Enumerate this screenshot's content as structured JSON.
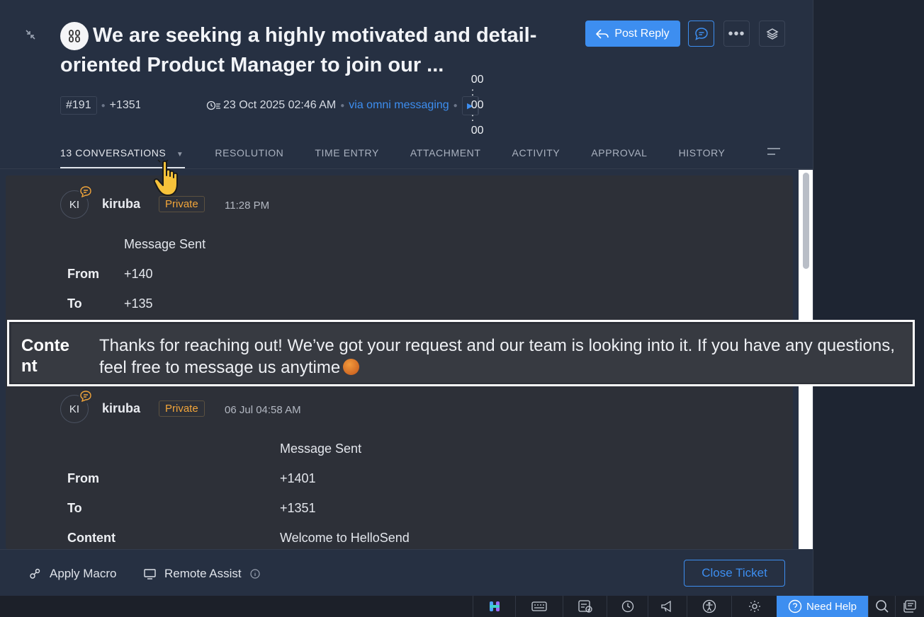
{
  "ticket": {
    "title": "We are seeking a highly motivated and detail-oriented Product Manager to join our ...",
    "id": "#191",
    "phone": "+1351",
    "created": "23 Oct 2025 02:46 AM",
    "channel": "via omni messaging",
    "timer": "00 : 00 : 00"
  },
  "header": {
    "post_reply": "Post Reply"
  },
  "tabs": [
    {
      "label": "13 CONVERSATIONS"
    },
    {
      "label": "RESOLUTION"
    },
    {
      "label": "TIME ENTRY"
    },
    {
      "label": "ATTACHMENT"
    },
    {
      "label": "ACTIVITY"
    },
    {
      "label": "APPROVAL"
    },
    {
      "label": "HISTORY"
    }
  ],
  "conversations": [
    {
      "initials": "KI",
      "author": "kiruba",
      "badge": "Private",
      "time": "11:28 PM",
      "heading": "Message Sent",
      "from_label": "From",
      "from": "+140",
      "to_label": "To",
      "to": "+135",
      "content_label": "Conte nt",
      "content": "Thanks for reaching out! We’ve got your request and our team is looking into it. If you have any questions, feel free to message us anytime"
    },
    {
      "initials": "KI",
      "author": "kiruba",
      "badge": "Private",
      "time": "06 Jul 04:58 AM",
      "heading": "Message Sent",
      "from_label": "From",
      "from": "+1401",
      "to_label": "To",
      "to": "+1351",
      "content_label": "Content",
      "content": "Welcome to HelloSend"
    }
  ],
  "footer": {
    "apply_macro": "Apply Macro",
    "remote_assist": "Remote Assist",
    "close_ticket": "Close Ticket"
  },
  "bottombar": {
    "need_help": "Need Help"
  },
  "colors": {
    "accent": "#3d8ef0",
    "private": "#f2a53a",
    "panel": "#263042"
  }
}
